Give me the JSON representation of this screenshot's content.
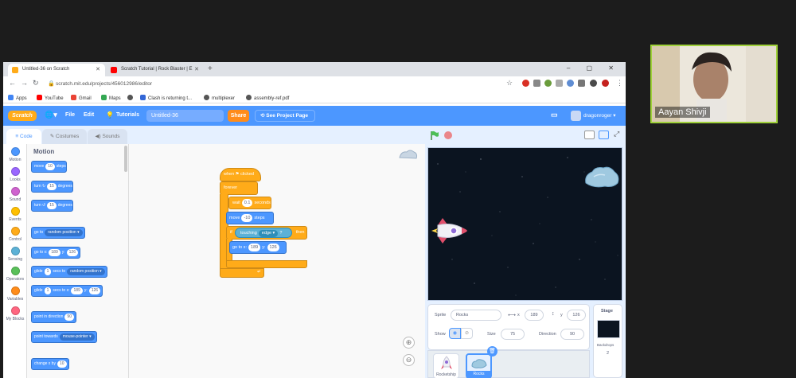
{
  "browser": {
    "tabs": [
      {
        "title": "Untitled-36 on Scratch",
        "active": true
      },
      {
        "title": "Scratch Tutorial | Rock Blaster | E",
        "active": false
      }
    ],
    "new_tab": "+",
    "window_controls": "–  ▢  ✕",
    "url": "scratch.mit.edu/projects/456012986/editor",
    "bookmarks": [
      "Apps",
      "YouTube",
      "Gmail",
      "Maps",
      "",
      "Clash is returning t...",
      "multiplexer",
      "assembly-ref.pdf"
    ]
  },
  "scratch_menu": {
    "logo": "Scratch",
    "file": "File",
    "edit": "Edit",
    "tutorials": "Tutorials",
    "project_title": "Untitled-36",
    "share": "Share",
    "see_project_page": "See Project Page",
    "username": "dragonroger"
  },
  "editor_tabs": {
    "code": "Code",
    "costumes": "Costumes",
    "sounds": "Sounds"
  },
  "categories": [
    {
      "label": "Motion",
      "color": "#4c97ff"
    },
    {
      "label": "Looks",
      "color": "#9966ff"
    },
    {
      "label": "Sound",
      "color": "#cf63cf"
    },
    {
      "label": "Events",
      "color": "#ffbf00"
    },
    {
      "label": "Control",
      "color": "#ffab19"
    },
    {
      "label": "Sensing",
      "color": "#5cb1d6"
    },
    {
      "label": "Operators",
      "color": "#59c059"
    },
    {
      "label": "Variables",
      "color": "#ff8c1a"
    },
    {
      "label": "My Blocks",
      "color": "#ff6680"
    }
  ],
  "palette": {
    "header": "Motion",
    "move": {
      "a": "move",
      "v": "10",
      "b": "steps"
    },
    "turn_right": {
      "a": "turn",
      "v": "15",
      "b": "degrees"
    },
    "turn_left": {
      "a": "turn",
      "v": "15",
      "b": "degrees"
    },
    "go_to": {
      "a": "go to",
      "dd": "random position ▾"
    },
    "go_to_xy": {
      "a": "go to x:",
      "x": "189",
      "b": "y:",
      "y": "126"
    },
    "glide_to": {
      "a": "glide",
      "v": "1",
      "b": "secs to",
      "dd": "random position ▾"
    },
    "glide_xy": {
      "a": "glide",
      "v": "1",
      "b": "secs to x:",
      "x": "189",
      "c": "y:",
      "y": "126"
    },
    "point_dir": {
      "a": "point in direction",
      "v": "90"
    },
    "point_towards": {
      "a": "point towards",
      "dd": "mouse-pointer ▾"
    },
    "change_x": {
      "a": "change x by",
      "v": "10"
    }
  },
  "script": {
    "hat": "when ⚑ clicked",
    "forever": "forever",
    "wait": {
      "a": "wait",
      "v": "0.1",
      "b": "seconds"
    },
    "move": {
      "a": "move",
      "v": "-10",
      "b": "steps"
    },
    "if": {
      "a": "if",
      "b": "then"
    },
    "touching": {
      "a": "touching",
      "dd": "edge ▾",
      "b": "?"
    },
    "go_to_xy": {
      "a": "go to x:",
      "x": "189",
      "b": "y:",
      "y": "126"
    }
  },
  "sprite_info": {
    "sprite_label": "Sprite",
    "sprite_name": "Rocks",
    "x_label": "x",
    "x": "189",
    "y_label": "y",
    "y": "126",
    "show_label": "Show",
    "size_label": "Size",
    "size": "75",
    "direction_label": "Direction",
    "direction": "90"
  },
  "sprites": [
    {
      "name": "Rocketship",
      "selected": false
    },
    {
      "name": "Rocks",
      "selected": true
    }
  ],
  "stage_panel": {
    "title": "Stage",
    "backdrops_label": "Backdrops",
    "backdrops_count": "2"
  },
  "webcam": {
    "name": "Aayan Shivji"
  },
  "colors": {
    "scratch_blue": "#4c97ff",
    "control_orange": "#ffab19",
    "sensing": "#5cb1d6",
    "webcam_border": "#9fd13a"
  }
}
